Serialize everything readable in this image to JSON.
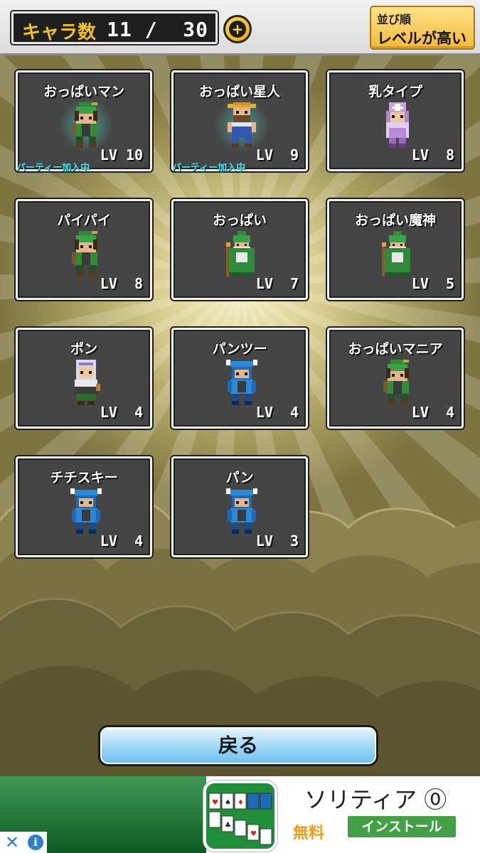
{
  "header": {
    "count_label": "キャラ数",
    "count_value": "11 /  30",
    "add_button": "plus-icon",
    "sort": {
      "title": "並び順",
      "value": "レベルが高い"
    }
  },
  "characters": [
    {
      "name": "おっぱいマン",
      "lv": "LV 10",
      "party": "パーティー加入中",
      "sprite": "green-elf"
    },
    {
      "name": "おっぱい星人",
      "lv": "LV  9",
      "party": "パーティー加入中",
      "sprite": "farmer"
    },
    {
      "name": "乳タイプ",
      "lv": "LV  8",
      "party": "",
      "sprite": "purple-priest"
    },
    {
      "name": "パイパイ",
      "lv": "LV  8",
      "party": "",
      "sprite": "green-elf"
    },
    {
      "name": "おっぱい",
      "lv": "LV  7",
      "party": "",
      "sprite": "green-wizard"
    },
    {
      "name": "おっぱい魔神",
      "lv": "LV  5",
      "party": "",
      "sprite": "green-wizard"
    },
    {
      "name": "ポン",
      "lv": "LV  4",
      "party": "",
      "sprite": "white-hood"
    },
    {
      "name": "パンツー",
      "lv": "LV  4",
      "party": "",
      "sprite": "blue-knight"
    },
    {
      "name": "おっぱいマニア",
      "lv": "LV  4",
      "party": "",
      "sprite": "green-elf"
    },
    {
      "name": "チチスキー",
      "lv": "LV  4",
      "party": "",
      "sprite": "blue-knight"
    },
    {
      "name": "パン",
      "lv": "LV  3",
      "party": "",
      "sprite": "blue-knight"
    }
  ],
  "back_button": "戻る",
  "ad": {
    "title": "ソリティア ⓪",
    "free": "無料",
    "install": "インストール",
    "close": "✕",
    "info": "i"
  }
}
